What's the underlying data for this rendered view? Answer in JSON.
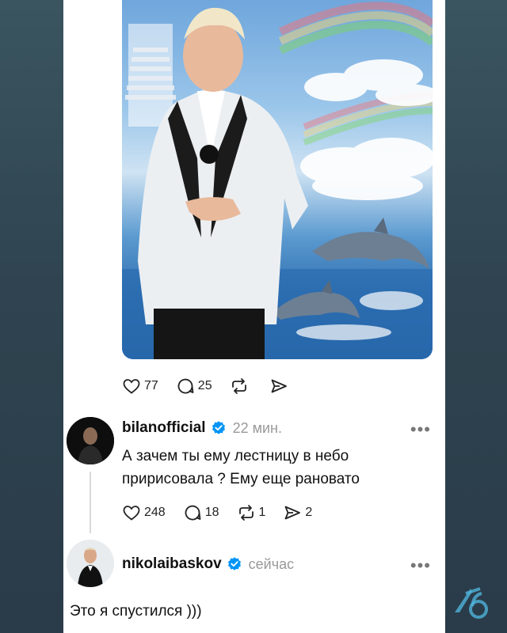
{
  "post": {
    "likes": "77",
    "replies": "25"
  },
  "comments": [
    {
      "username": "bilanofficial",
      "time": "22 мин.",
      "text": "А зачем ты ему лестницу в небо пририсовала ? Ему еще рановато",
      "likes": "248",
      "replies": "18",
      "reposts": "1",
      "shares": "2"
    },
    {
      "username": "nikolaibaskov",
      "time": "сейчас",
      "text": "Это я спустился )))"
    }
  ],
  "more_label": "•••",
  "colors": {
    "verified": "#0095f6",
    "thread_line": "#d9d9d9",
    "background": "#2f4450"
  },
  "icons": [
    "heart-icon",
    "comment-icon",
    "repost-icon",
    "share-icon",
    "verified-badge-icon",
    "watermark-logo"
  ]
}
